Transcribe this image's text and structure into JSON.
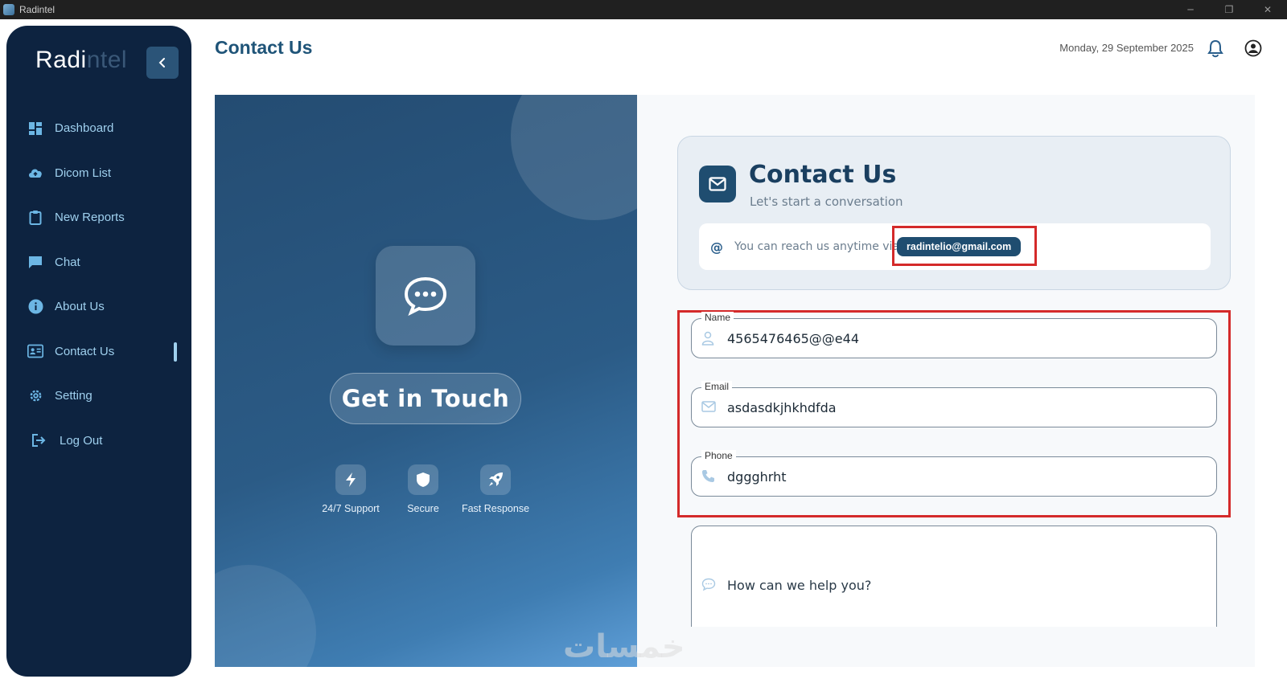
{
  "window": {
    "title": "Radintel",
    "minimize": "─",
    "maximize": "❐",
    "close": "✕"
  },
  "sidebar": {
    "logo_main": "Radi",
    "logo_faded": "ntel",
    "collapse_glyph": "‹",
    "items": [
      {
        "label": "Dashboard",
        "icon": "dashboard-icon"
      },
      {
        "label": "Dicom List",
        "icon": "cloud-upload-icon"
      },
      {
        "label": "New Reports",
        "icon": "clipboard-icon"
      },
      {
        "label": "Chat",
        "icon": "chat-icon"
      },
      {
        "label": "About Us",
        "icon": "info-icon"
      },
      {
        "label": "Contact Us",
        "icon": "contact-card-icon",
        "active": true
      },
      {
        "label": "Setting",
        "icon": "gear-icon"
      },
      {
        "label": "Log Out",
        "icon": "logout-icon"
      }
    ]
  },
  "header": {
    "title": "Contact Us",
    "date": "Monday, 29 September 2025"
  },
  "hero": {
    "button_label": "Get in Touch",
    "features": [
      {
        "label": "24/7 Support",
        "icon": "bolt-icon"
      },
      {
        "label": "Secure",
        "icon": "shield-icon"
      },
      {
        "label": "Fast Response",
        "icon": "rocket-icon"
      }
    ]
  },
  "contact_card": {
    "title": "Contact Us",
    "subtitle": "Let's start a conversation",
    "reach_text": "You can reach us anytime via",
    "email": "radintelio@gmail.com"
  },
  "form": {
    "name": {
      "label": "Name",
      "value": "4565476465@@e44"
    },
    "email": {
      "label": "Email",
      "value": "asdasdkjhkhdfda"
    },
    "phone": {
      "label": "Phone",
      "value": "dggghrht"
    },
    "message": {
      "placeholder": "How can we help you?"
    }
  },
  "watermark": "خمسات",
  "colors": {
    "sidebar": "#0d2340",
    "accent": "#1f5478",
    "highlight": "#d42a2a"
  }
}
